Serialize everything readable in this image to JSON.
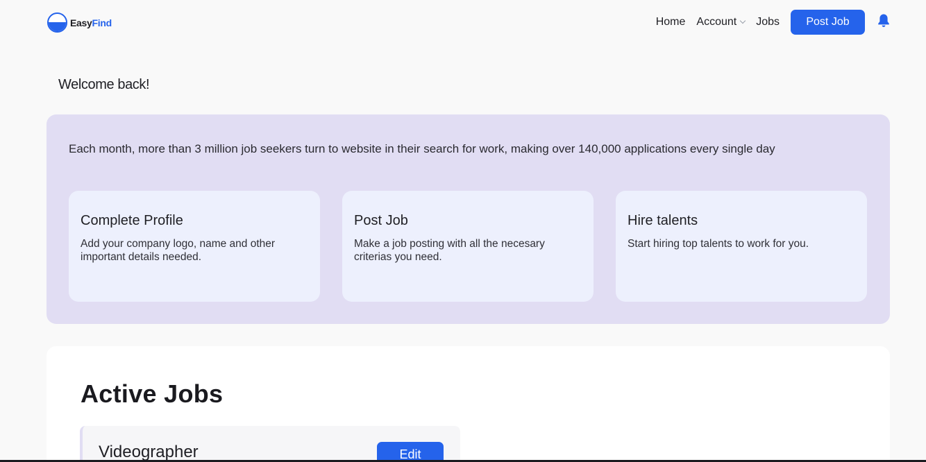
{
  "brand": {
    "name_part1": "Easy",
    "name_part2": "Find",
    "accent": "#2563eb"
  },
  "nav": {
    "home": "Home",
    "account": "Account",
    "jobs": "Jobs",
    "post_job": "Post Job",
    "notification_icon": "bell-icon"
  },
  "welcome": "Welcome back!",
  "banner": {
    "text": "Each month, more than 3 million job seekers turn to website in their search for work, making over 140,000 applications every single day",
    "cards": [
      {
        "title": "Complete Profile",
        "desc": "Add your company logo, name and other important details needed."
      },
      {
        "title": "Post Job",
        "desc": "Make a job posting with all the necesary criterias you need."
      },
      {
        "title": "Hire talents",
        "desc": "Start hiring top talents to work for you."
      }
    ]
  },
  "active_jobs": {
    "title": "Active Jobs",
    "items": [
      {
        "name": "Videographer",
        "edit_label": "Edit"
      }
    ]
  }
}
